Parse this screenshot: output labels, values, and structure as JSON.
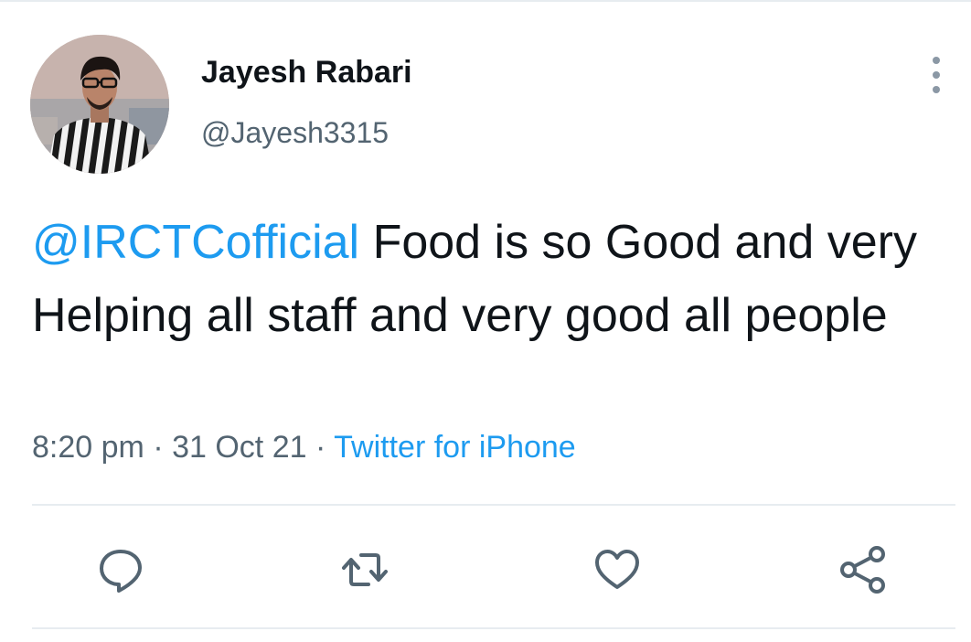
{
  "tweet": {
    "author": {
      "display_name": "Jayesh Rabari",
      "handle": "@Jayesh3315"
    },
    "body": {
      "mention": "@IRCTCofficial",
      "text": "Food is so Good and very Helping all staff and very good all people"
    },
    "meta": {
      "time": "8:20 pm",
      "separator": "·",
      "date": "31 Oct 21",
      "source": "Twitter for iPhone"
    }
  },
  "actions": [
    {
      "icon": "reply-icon"
    },
    {
      "icon": "retweet-icon"
    },
    {
      "icon": "like-icon"
    },
    {
      "icon": "share-icon"
    }
  ],
  "colors": {
    "text": "#0f1419",
    "secondary": "#536471",
    "accent": "#1d9bf0",
    "divider": "#e7ecf0"
  }
}
